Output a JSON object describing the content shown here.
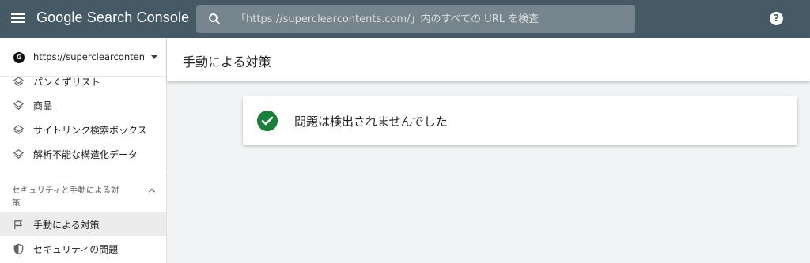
{
  "header": {
    "app_title": "Google Search Console",
    "search_placeholder": "「https://superclearcontents.com/」内のすべての URL を検査",
    "help_symbol": "?"
  },
  "sidebar": {
    "property": {
      "favicon_letter": "G",
      "url": "https://superclearcontents.c..."
    },
    "items": [
      {
        "label": "パンくずリスト",
        "icon": "layers-icon"
      },
      {
        "label": "商品",
        "icon": "layers-icon"
      },
      {
        "label": "サイトリンク検索ボックス",
        "icon": "layers-icon"
      },
      {
        "label": "解析不能な構造化データ",
        "icon": "layers-icon"
      }
    ],
    "section": {
      "line1": "セキュリティと手動による対",
      "line2": "策",
      "expanded": true
    },
    "section_items": [
      {
        "label": "手動による対策",
        "icon": "flag-icon",
        "active": true
      },
      {
        "label": "セキュリティの問題",
        "icon": "shield-icon",
        "active": false
      }
    ]
  },
  "main": {
    "page_title": "手動による対策",
    "status_message": "問題は検出されませんでした"
  },
  "colors": {
    "topbar": "#455a64",
    "search_bg": "#76858d",
    "success": "#188038",
    "active_bg": "#ececec"
  }
}
